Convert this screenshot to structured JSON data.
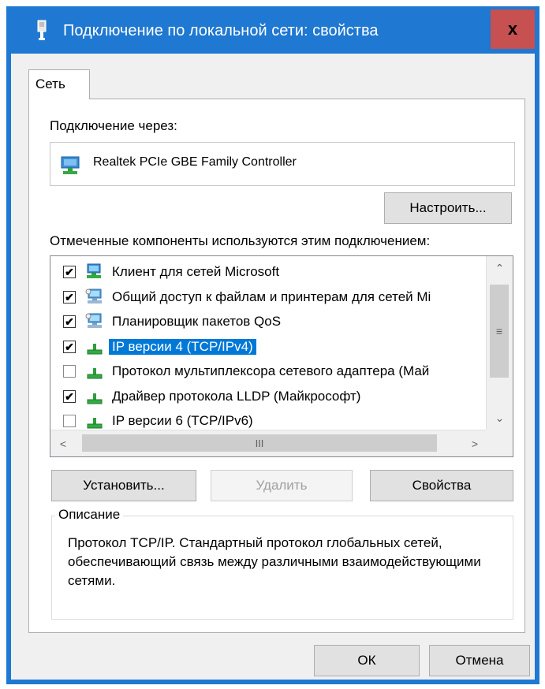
{
  "window": {
    "title": "Подключение по локальной сети: свойства",
    "close_label": "x",
    "accent": "#1f78d1"
  },
  "tabs": [
    {
      "label": "Сеть",
      "selected": true
    }
  ],
  "connect": {
    "label": "Подключение через:",
    "adapter_name": "Realtek PCIe GBE Family Controller",
    "configure_button": "Настроить..."
  },
  "components": {
    "label": "Отмеченные компоненты используются этим подключением:",
    "items": [
      {
        "label": "Клиент для сетей Microsoft",
        "checked": true,
        "icon": "network-client-icon",
        "selected": false
      },
      {
        "label": "Общий доступ к файлам и принтерам для сетей Mi",
        "checked": true,
        "icon": "network-service-icon",
        "selected": false
      },
      {
        "label": "Планировщик пакетов QoS",
        "checked": true,
        "icon": "network-service-icon",
        "selected": false
      },
      {
        "label": "IP версии 4 (TCP/IPv4)",
        "checked": true,
        "icon": "protocol-icon",
        "selected": true
      },
      {
        "label": "Протокол мультиплексора сетевого адаптера (Май",
        "checked": false,
        "icon": "protocol-icon",
        "selected": false
      },
      {
        "label": "Драйвер протокола LLDP (Майкрософт)",
        "checked": true,
        "icon": "protocol-icon",
        "selected": false
      },
      {
        "label": "IP версии 6 (TCP/IPv6)",
        "checked": false,
        "icon": "protocol-icon",
        "selected": false
      }
    ],
    "selection_color": "#0078d7"
  },
  "actions": {
    "install": "Установить...",
    "remove": "Удалить",
    "properties": "Свойства"
  },
  "description": {
    "legend": "Описание",
    "text": "Протокол TCP/IP. Стандартный протокол глобальных сетей, обеспечивающий связь между различными взаимодействующими сетями."
  },
  "footer": {
    "ok": "ОК",
    "cancel": "Отмена"
  }
}
